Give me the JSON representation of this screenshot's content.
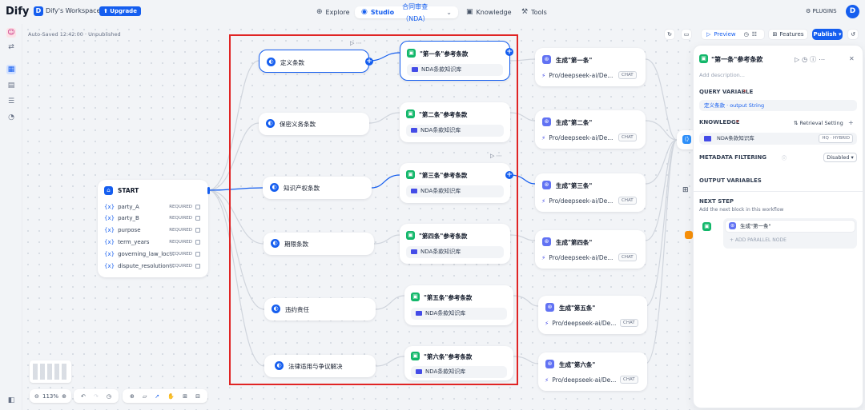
{
  "app": {
    "logo": "Dify"
  },
  "workspace": {
    "initial": "D",
    "name": "Dify's Workspace ▾",
    "upgrade": "⬆ Upgrade"
  },
  "nav": {
    "explore": "Explore",
    "studio": "Studio",
    "app_name": "合同审查（NDA）",
    "knowledge": "Knowledge",
    "tools": "Tools"
  },
  "user": {
    "plugins": "PLUGINS",
    "avatar": "D"
  },
  "toolbar": {
    "autosaved": "Auto-Saved 12:42:00 · Unpublished",
    "preview": "Preview",
    "features": "Features",
    "publish": "Publish ▾"
  },
  "start_node": {
    "title": "START",
    "variables": [
      {
        "name": "party_A",
        "tag": "REQUIRED"
      },
      {
        "name": "party_B",
        "tag": "REQUIRED"
      },
      {
        "name": "purpose",
        "tag": "REQUIRED"
      },
      {
        "name": "term_years",
        "tag": "REQUIRED"
      },
      {
        "name": "governing_law_loc...",
        "tag": "REQUIRED"
      },
      {
        "name": "dispute_resolution...",
        "tag": "REQUIRED"
      }
    ]
  },
  "question_nodes": [
    {
      "title": "定义条款"
    },
    {
      "title": "保密义务条款"
    },
    {
      "title": "知识产权条款"
    },
    {
      "title": "期限条款"
    },
    {
      "title": "违约责任"
    },
    {
      "title": "法律适用与争议解决"
    }
  ],
  "knowledge_nodes": [
    {
      "title": "\"第一条\"参考条款",
      "kb": "NDA条款知识库"
    },
    {
      "title": "\"第二条\"参考条款",
      "kb": "NDA条款知识库"
    },
    {
      "title": "\"第三条\"参考条款",
      "kb": "NDA条款知识库"
    },
    {
      "title": "\"第四条\"参考条款",
      "kb": "NDA条款知识库"
    },
    {
      "title": "\"第五条\"参考条款",
      "kb": "NDA条款知识库"
    },
    {
      "title": "\"第六条\"参考条款",
      "kb": "NDA条款知识库"
    }
  ],
  "llm_nodes": [
    {
      "title": "生成\"第一条\"",
      "model": "Pro/deepseek-ai/De...",
      "mode": "CHAT"
    },
    {
      "title": "生成\"第二条\"",
      "model": "Pro/deepseek-ai/De...",
      "mode": "CHAT"
    },
    {
      "title": "生成\"第三条\"",
      "model": "Pro/deepseek-ai/De...",
      "mode": "CHAT"
    },
    {
      "title": "生成\"第四条\"",
      "model": "Pro/deepseek-ai/De...",
      "mode": "CHAT"
    },
    {
      "title": "生成\"第五条\"",
      "model": "Pro/deepseek-ai/De...",
      "mode": "CHAT"
    },
    {
      "title": "生成\"第六条\"",
      "model": "Pro/deepseek-ai/De...",
      "mode": "CHAT"
    }
  ],
  "panel": {
    "title": "\"第一条\"参考条款",
    "description_placeholder": "Add description...",
    "query_variable_label": "QUERY VARIABLE",
    "query_variable_value": "定义条款 · output String",
    "knowledge_label": "KNOWLEDGE",
    "retrieval_setting": "Retrieval Setting",
    "kb_name": "NDA条款知识库",
    "kb_tag": "HQ · HYBRID",
    "metadata_label": "METADATA FILTERING",
    "metadata_value": "Disabled ▾",
    "output_label": "OUTPUT VARIABLES",
    "next_step_label": "NEXT STEP",
    "next_step_desc": "Add the next block in this workflow",
    "next_node": "生成\"第一条\"",
    "add_parallel": "+ ADD PARALLEL NODE"
  },
  "zoom": "113%",
  "colors": {
    "accent": "#155eef",
    "knowledge": "#12b76a",
    "llm": "#6172f3",
    "highlight": "#e02424"
  }
}
